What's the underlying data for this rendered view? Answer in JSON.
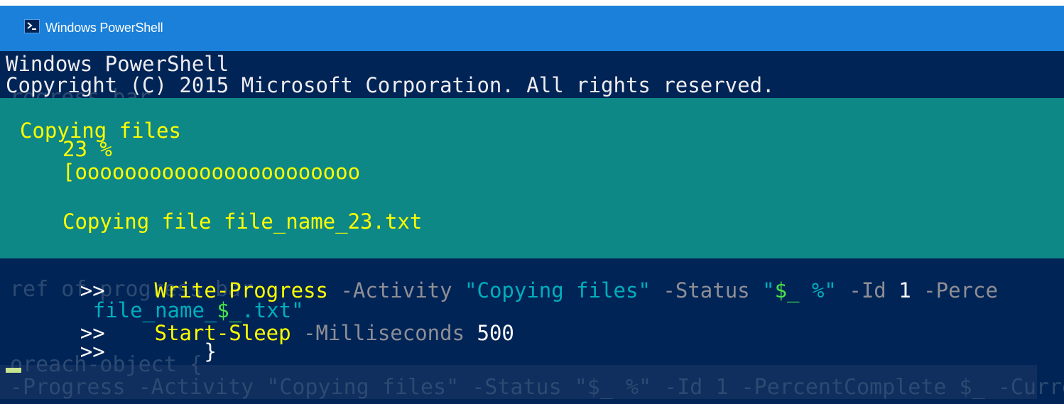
{
  "window": {
    "title": "Windows PowerShell",
    "title_color": "#1a80d9",
    "background_color": "#012456",
    "progress_color": "#0e8787"
  },
  "console": {
    "header_line1": "Windows PowerShell",
    "header_line2": "Copyright (C) 2015 Microsoft Corporation. All rights reserved.",
    "progress": {
      "activity": "Copying files",
      "percent_text": "23 %",
      "percent_value": 23,
      "bar": "[ooooooooooooooooooooooo",
      "status": "Copying file file_name_23.txt"
    },
    "prompt": ">>",
    "lines": {
      "l1_cmd": "Write-Progress",
      "l1_p1": "-Activity",
      "l1_s1": "\"Copying files\"",
      "l1_p2": "-Status",
      "l1_s2a": "\"",
      "l1_var1": "$_",
      "l1_s2b": " %\"",
      "l1_p3": "-Id",
      "l1_n1": "1",
      "l1_p4": "-Perce",
      "l2_s1": "file_name_",
      "l2_var": "$_",
      "l2_s2": ".txt\"",
      "l3_cmd": "Start-Sleep",
      "l3_p1": "-Milliseconds",
      "l3_n1": "500",
      "l4_brace": "}"
    },
    "ghost_text": {
      "g1": "rogress bar",
      "g2": "ref of progress bar",
      "g3": "oreach-object {",
      "g4": "-Progress -Activity \"Copying files\" -Status \"$_ %\" -Id 1 -PercentComplete $_ -Current"
    }
  }
}
